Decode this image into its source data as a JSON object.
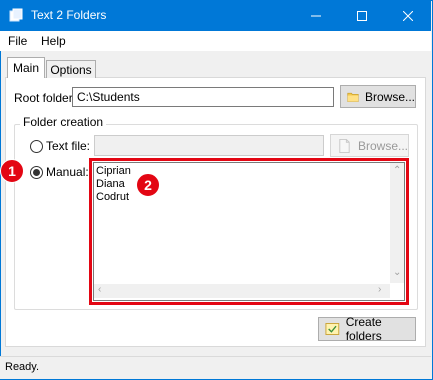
{
  "window": {
    "title": "Text 2 Folders",
    "accent_color": "#0078d7",
    "controls": {
      "minimize_icon": "minimize-icon",
      "maximize_icon": "maximize-icon",
      "close_icon": "close-icon"
    }
  },
  "menu": {
    "items": [
      "File",
      "Help"
    ]
  },
  "tabs": [
    {
      "label": "Main",
      "selected": true
    },
    {
      "label": "Options",
      "selected": false
    }
  ],
  "root_folder": {
    "label": "Root folder:",
    "value": "C:\\Students",
    "browse_label": "Browse...",
    "browse_icon": "folder-icon"
  },
  "folder_creation": {
    "group_label": "Folder creation",
    "text_file": {
      "label": "Text file:",
      "value": "",
      "browse_label": "Browse...",
      "browse_icon": "document-icon",
      "enabled": false,
      "checked": false
    },
    "manual": {
      "label": "Manual:",
      "checked": true,
      "text": "Ciprian\nDiana\nCodrut"
    }
  },
  "annotations": {
    "badge_1": "1",
    "badge_2": "2",
    "highlight_color": "#e30613"
  },
  "create_button": {
    "label": "Create folders",
    "icon": "create-folders-icon"
  },
  "status": {
    "text": "Ready."
  }
}
